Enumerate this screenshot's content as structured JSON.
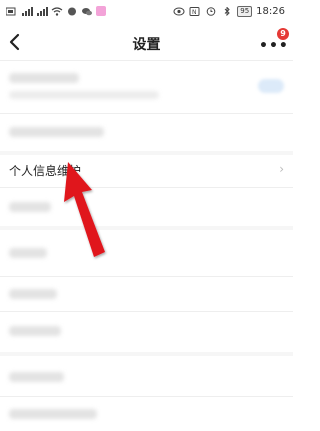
{
  "status": {
    "time": "18:26",
    "battery": "95",
    "left_icons": [
      "sim-icon",
      "signal-icon",
      "signal-icon",
      "wifi-icon",
      "message-icon",
      "wechat-icon",
      "app-icon"
    ],
    "right_icons": [
      "eye-icon",
      "nfc-icon",
      "alarm-icon",
      "bluetooth-icon"
    ]
  },
  "header": {
    "title": "设置",
    "badge_count": "9"
  },
  "menu": {
    "personal_info_label": "个人信息维护"
  },
  "colors": {
    "badge": "#e53935",
    "arrow": "#e0141e"
  }
}
